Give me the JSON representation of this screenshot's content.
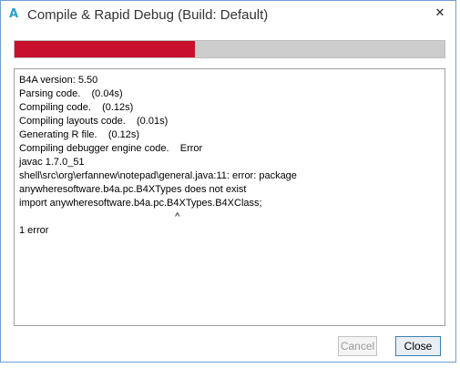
{
  "window": {
    "app_icon_glyph": "A",
    "title": "Compile & Rapid Debug (Build: Default)",
    "close_glyph": "✕",
    "accent_color": "#2aa3c7"
  },
  "progress": {
    "fraction": 0.42,
    "fill_color": "#c8102e",
    "track_color": "#cccccc"
  },
  "log": {
    "lines": [
      "B4A version: 5.50",
      "Parsing code.    (0.04s)",
      "Compiling code.    (0.12s)",
      "Compiling layouts code.    (0.01s)",
      "Generating R file.    (0.12s)",
      "Compiling debugger engine code.    Error",
      "javac 1.7.0_51",
      "shell\\src\\org\\erfannew\\notepad\\general.java:11: error: package",
      "anywheresoftware.b4a.pc.B4XTypes does not exist",
      "import anywheresoftware.b4a.pc.B4XTypes.B4XClass;",
      "                                                        ^",
      "1 error"
    ]
  },
  "buttons": {
    "cancel_label": "Cancel",
    "close_label": "Close"
  }
}
